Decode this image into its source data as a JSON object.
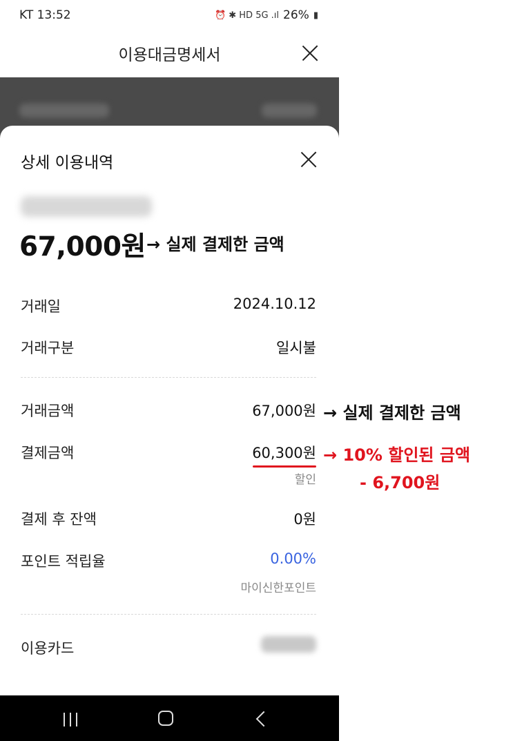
{
  "status_bar": {
    "carrier_time": "KT 13:52",
    "carrier_icon": "notification-icons",
    "indicators": "⏰ ✱ HD 5G .ıl",
    "battery": "26%"
  },
  "header": {
    "title": "이용대금명세서",
    "close_icon": "close-icon"
  },
  "sheet": {
    "title": "상세 이용내역",
    "amount": "67,000원",
    "amount_note": "→ 실제 결제한 금액",
    "rows": {
      "trade_date": {
        "label": "거래일",
        "value": "2024.10.12"
      },
      "trade_type": {
        "label": "거래구분",
        "value": "일시불"
      },
      "trade_amount": {
        "label": "거래금액",
        "value": "67,000원"
      },
      "pay_amount": {
        "label": "결제금액",
        "value": "60,300원",
        "sub": "할인"
      },
      "balance": {
        "label": "결제 후 잔액",
        "value": "0원"
      },
      "point_rate": {
        "label": "포인트 적립율",
        "value": "0.00%",
        "sub": "마이신한포인트"
      },
      "card": {
        "label": "이용카드"
      }
    }
  },
  "annotations": {
    "trade_amount_note": "→ 실제 결제한 금액",
    "pay_amount_note_line1": "→ 10% 할인된 금액",
    "pay_amount_note_line2": "- 6,700원"
  },
  "colors": {
    "accent_red": "#e0141e",
    "accent_blue": "#3a64e0",
    "dim_overlay": "#4a4a4a"
  }
}
